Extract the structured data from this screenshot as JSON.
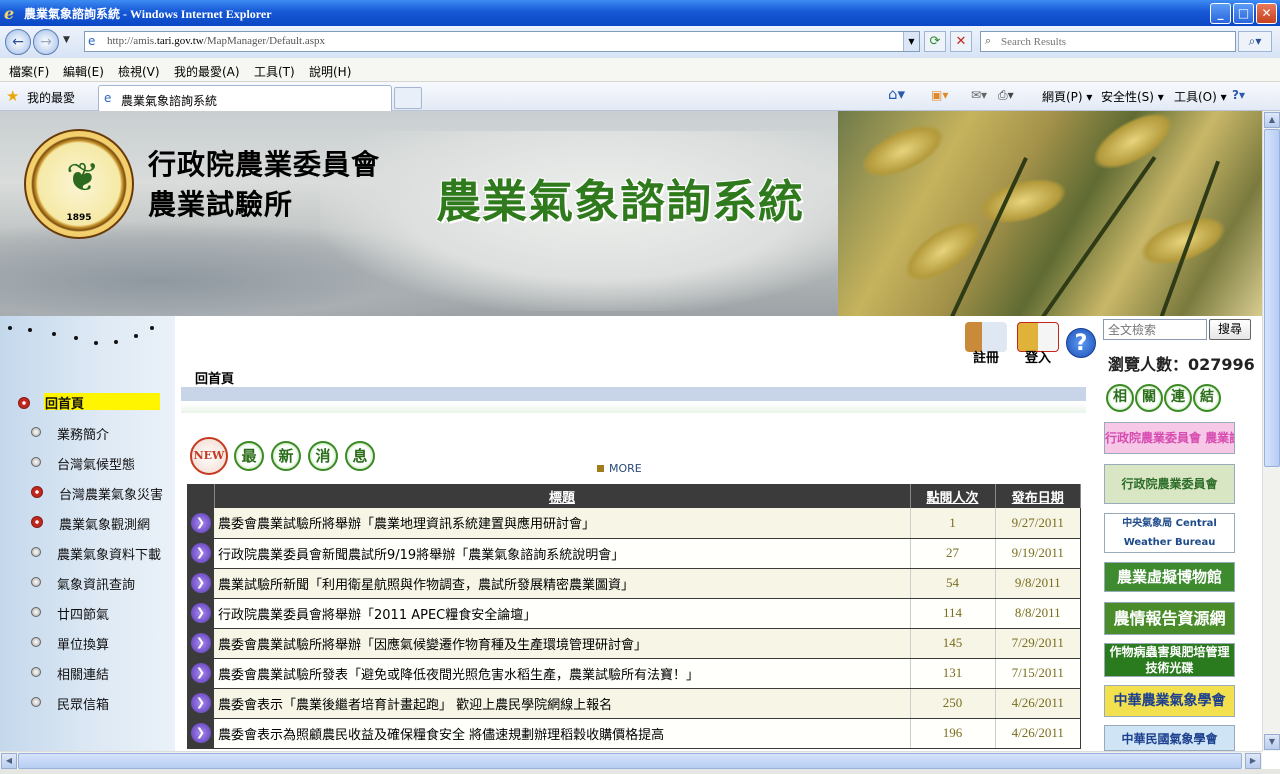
{
  "window": {
    "title": "農業氣象諮詢系統 - Windows Internet Explorer",
    "buttons": {
      "minimize": "_",
      "maximize": "□",
      "close": "✕"
    }
  },
  "address_bar": {
    "url_prefix": "http://amis.",
    "url_host": "tari.gov.tw",
    "url_path": "/MapManager/Default.aspx",
    "search_placeholder": "Search Results"
  },
  "menu": [
    "檔案(F)",
    "編輯(E)",
    "檢視(V)",
    "我的最愛(A)",
    "工具(T)",
    "說明(H)"
  ],
  "favorites_bar": {
    "favorites_label": "我的最愛",
    "tab_label": "農業氣象諮詢系統",
    "commands": {
      "page": "網頁(P)",
      "safety": "安全性(S)",
      "tools": "工具(O)"
    }
  },
  "banner": {
    "org_line1": "行政院農業委員會",
    "org_line2": "農業試驗所",
    "system_title": "農業氣象諮詢系統",
    "logo_year": "1895"
  },
  "sidebar": {
    "items": [
      {
        "label": "回首頁",
        "active": true,
        "bullet": "red"
      },
      {
        "label": "業務簡介",
        "bullet": "gray"
      },
      {
        "label": "台灣氣候型態",
        "bullet": "gray"
      },
      {
        "label": "台灣農業氣象災害",
        "bullet": "red"
      },
      {
        "label": "農業氣象觀測網",
        "bullet": "red"
      },
      {
        "label": "農業氣象資料下載",
        "bullet": "gray"
      },
      {
        "label": "氣象資訊查詢",
        "bullet": "gray"
      },
      {
        "label": "廿四節氣",
        "bullet": "gray"
      },
      {
        "label": "單位換算",
        "bullet": "gray"
      },
      {
        "label": "相關連結",
        "bullet": "gray"
      },
      {
        "label": "民眾信箱",
        "bullet": "gray"
      }
    ]
  },
  "user_tools": {
    "register": "註冊",
    "login": "登入",
    "help": "?"
  },
  "breadcrumb": "回首頁",
  "news": {
    "badge_new": "NEW",
    "title_chars": [
      "最",
      "新",
      "消",
      "息"
    ],
    "more": "MORE",
    "columns": [
      "標題",
      "點閱人次",
      "發布日期"
    ],
    "rows": [
      {
        "title": "農委會農業試驗所將舉辦「農業地理資訊系統建置與應用研討會」",
        "hits": "1",
        "date": "9/27/2011"
      },
      {
        "title": "行政院農業委員會新聞農試所9/19將舉辦「農業氣象諮詢系統說明會」",
        "hits": "27",
        "date": "9/19/2011"
      },
      {
        "title": "農業試驗所新聞「利用衛星航照與作物調查，農試所發展精密農業圖資」",
        "hits": "54",
        "date": "9/8/2011"
      },
      {
        "title": "行政院農業委員會將舉辦「2011 APEC糧食安全論壇」",
        "hits": "114",
        "date": "8/8/2011"
      },
      {
        "title": "農委會農業試驗所將舉辦「因應氣候變遷作物育種及生產環境管理研討會」",
        "hits": "145",
        "date": "7/29/2011"
      },
      {
        "title": "農委會農業試驗所發表「避免或降低夜間光照危害水稻生產，農業試驗所有法寶！」",
        "hits": "131",
        "date": "7/15/2011"
      },
      {
        "title": "農委會表示「農業後繼者培育計畫起跑」 歡迎上農民學院網線上報名",
        "hits": "250",
        "date": "4/26/2011"
      },
      {
        "title": "農委會表示為照顧農民收益及確保糧食安全 將儘速規劃辦理稻穀收購價格提高",
        "hits": "196",
        "date": "4/26/2011"
      }
    ]
  },
  "right_panel": {
    "search_placeholder": "全文檢索",
    "search_button": "搜尋",
    "visitors": "瀏覽人數：027996",
    "related_chars": [
      "相",
      "關",
      "連",
      "結"
    ],
    "links": [
      {
        "text": "行政院農業委員會 農業試驗所",
        "color": "#d64cb0",
        "bg": "#f6c7e6"
      },
      {
        "text": "行政院農業委員會",
        "color": "#2e6d2a",
        "bg": "#d9e6c4"
      },
      {
        "text": "中央氣象局 Central Weather Bureau",
        "color": "#1d4a8a",
        "bg": "#ffffff"
      },
      {
        "text": "農業虛擬博物館",
        "color": "#ffffff",
        "bg": "#3d8a2f"
      },
      {
        "text": "農情報告資源網",
        "color": "#ffffff",
        "bg": "#4a8c2a"
      },
      {
        "text": "作物病蟲害與肥培管理技術光碟",
        "color": "#ffffff",
        "bg": "#2a7a1e"
      },
      {
        "text": "中華農業氣象學會",
        "color": "#1c3f8f",
        "bg": "#f3e04e"
      },
      {
        "text": "中華民國氣象學會",
        "color": "#1c3f8f",
        "bg": "#cfe4f5"
      }
    ]
  }
}
